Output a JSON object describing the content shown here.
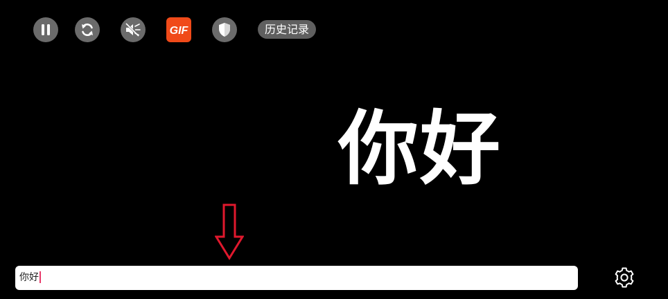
{
  "toolbar": {
    "buttons": [
      {
        "name": "pause",
        "icon": "pause-icon"
      },
      {
        "name": "refresh",
        "icon": "refresh-icon"
      },
      {
        "name": "mute",
        "icon": "speaker-muted-icon"
      },
      {
        "name": "gif",
        "icon": "gif-icon",
        "label": "GIF"
      },
      {
        "name": "shield",
        "icon": "shield-icon"
      }
    ],
    "history_label": "历史记录"
  },
  "display": {
    "text": "你好"
  },
  "input": {
    "value": "你好"
  },
  "colors": {
    "background": "#000000",
    "button_bg": "#6b6b6b",
    "gif_bg": "#f04a19",
    "arrow": "#e0182d",
    "caret": "#e83a6a"
  },
  "settings": {
    "icon": "gear-icon"
  }
}
